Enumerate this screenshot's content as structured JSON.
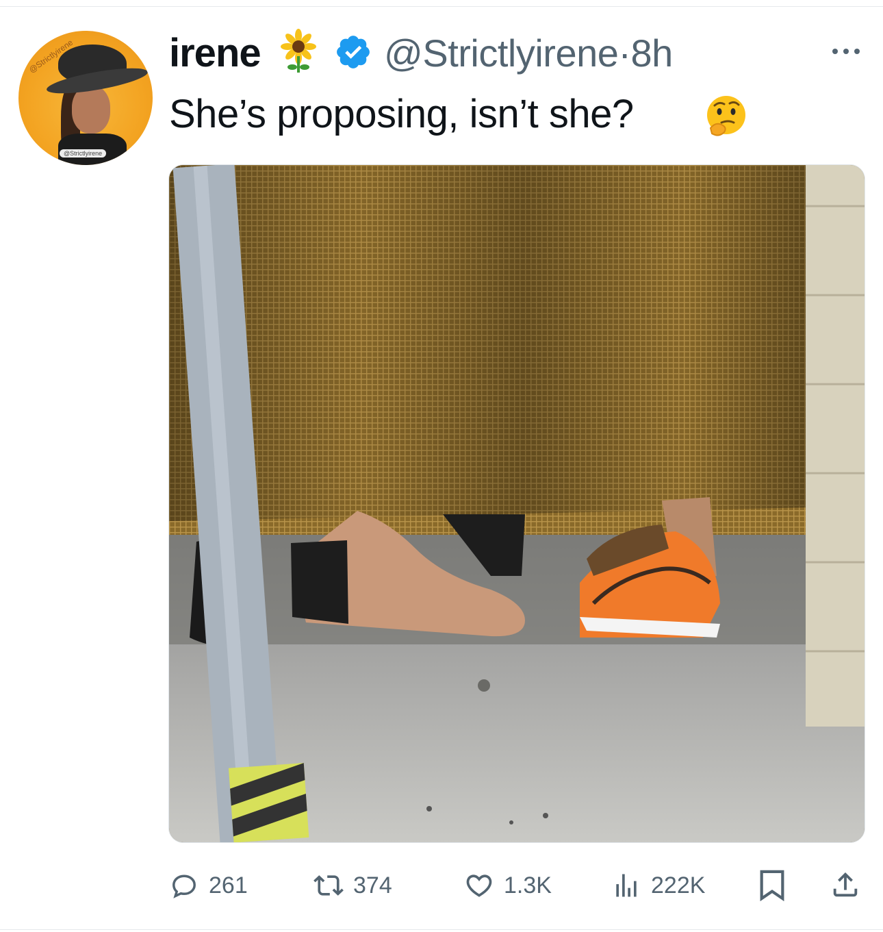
{
  "tweet": {
    "display_name": "irene",
    "name_emoji": "sunflower",
    "verified": true,
    "handle": "@Strictlyirene",
    "separator": "·",
    "time": "8h",
    "text": "She’s proposing, isn’t she?",
    "text_emoji": "thinking-face",
    "avatar_watermark": "@Strictlyirene",
    "avatar_tag": "@Strictlyirene"
  },
  "actions": {
    "replies": "261",
    "retweets": "374",
    "likes": "1.3K",
    "views": "222K"
  },
  "colors": {
    "text": "#0f1419",
    "secondary": "#536471",
    "verified_blue": "#1d9bf0",
    "avatar_bg": "#f3a321"
  },
  "icons": [
    "more-icon",
    "reply-icon",
    "retweet-icon",
    "like-icon",
    "views-icon",
    "bookmark-icon",
    "share-icon",
    "verified-icon"
  ]
}
